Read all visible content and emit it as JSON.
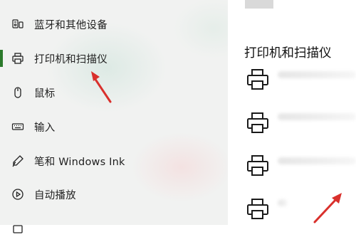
{
  "sidebar": {
    "items": [
      {
        "label": "蓝牙和其他设备",
        "icon": "bluetooth-device-icon"
      },
      {
        "label": "打印机和扫描仪",
        "icon": "printer-icon",
        "selected": true
      },
      {
        "label": "鼠标",
        "icon": "mouse-icon"
      },
      {
        "label": "输入",
        "icon": "keyboard-icon"
      },
      {
        "label": "笔和 Windows Ink",
        "icon": "pen-icon"
      },
      {
        "label": "自动播放",
        "icon": "autoplay-icon"
      }
    ],
    "accent_color": "#2b7a2b"
  },
  "main": {
    "title": "打印机和扫描仪",
    "printer_icon": "printer-icon",
    "printers": [
      {
        "name_visible": false
      },
      {
        "name_visible": false
      },
      {
        "name_visible": false
      },
      {
        "name_visible": false
      }
    ]
  },
  "annotations": {
    "arrow_color": "#d9302c"
  }
}
